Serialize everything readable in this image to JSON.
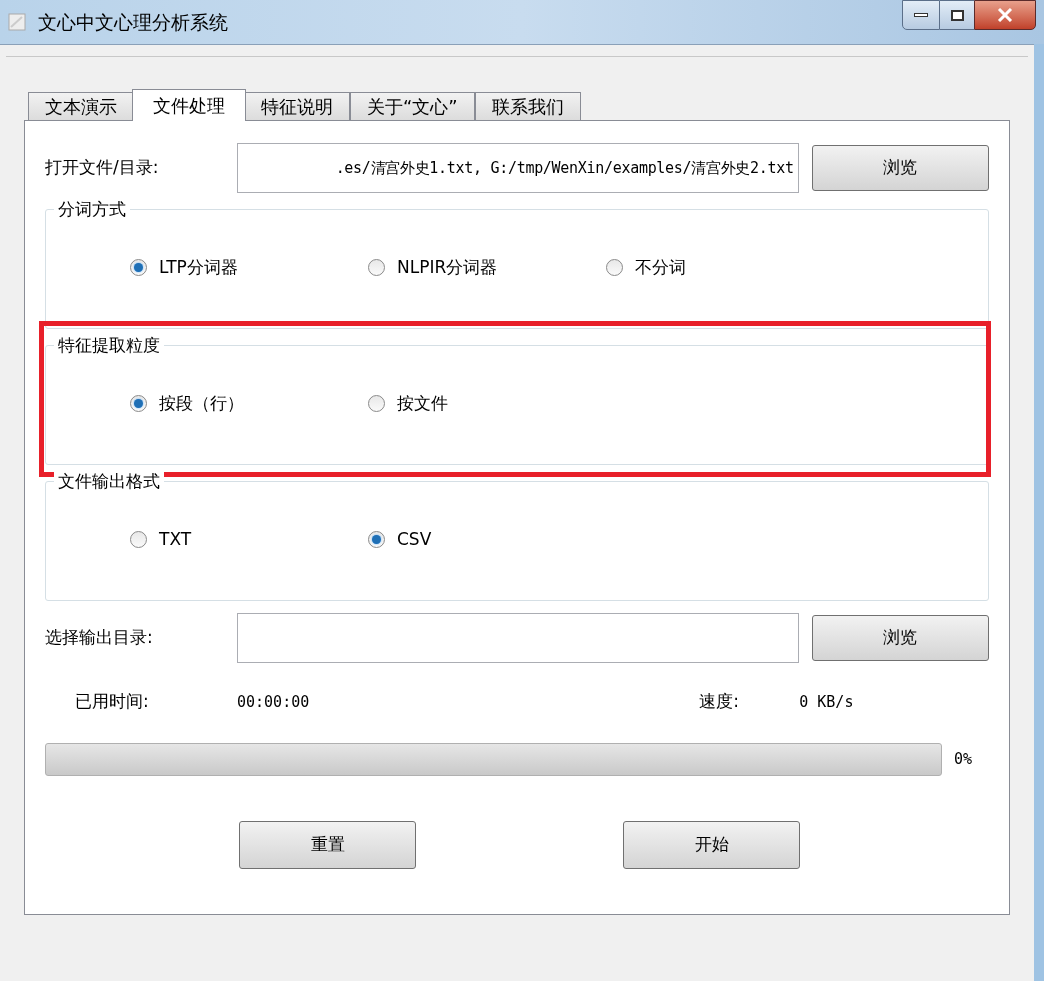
{
  "window": {
    "title": "文心中文心理分析系统"
  },
  "tabs": [
    {
      "label": "文本演示",
      "selected": false
    },
    {
      "label": "文件处理",
      "selected": true
    },
    {
      "label": "特征说明",
      "selected": false
    },
    {
      "label": "关于“文心”",
      "selected": false
    },
    {
      "label": "联系我们",
      "selected": false
    }
  ],
  "open_file": {
    "label": "打开文件/目录:",
    "value": ".es/清宫外史1.txt, G:/tmp/WenXin/examples/清宫外史2.txt",
    "button": "浏览"
  },
  "groups": [
    {
      "title": "分词方式",
      "highlighted": false,
      "options": [
        {
          "label": "LTP分词器",
          "selected": true
        },
        {
          "label": "NLPIR分词器",
          "selected": false
        },
        {
          "label": "不分词",
          "selected": false
        }
      ]
    },
    {
      "title": "特征提取粒度",
      "highlighted": true,
      "options": [
        {
          "label": "按段（行）",
          "selected": true
        },
        {
          "label": "按文件",
          "selected": false
        }
      ]
    },
    {
      "title": "文件输出格式",
      "highlighted": false,
      "options": [
        {
          "label": "TXT",
          "selected": false
        },
        {
          "label": "CSV",
          "selected": true
        }
      ]
    }
  ],
  "output_dir": {
    "label": "选择输出目录:",
    "button": "浏览"
  },
  "elapsed": {
    "label": "已用时间:",
    "value": "00:00:00"
  },
  "speed": {
    "label": "速度:",
    "value": "0 KB/s"
  },
  "progress": {
    "level": 0,
    "reading": "0%"
  },
  "buttons": [
    "重置",
    "开始"
  ]
}
